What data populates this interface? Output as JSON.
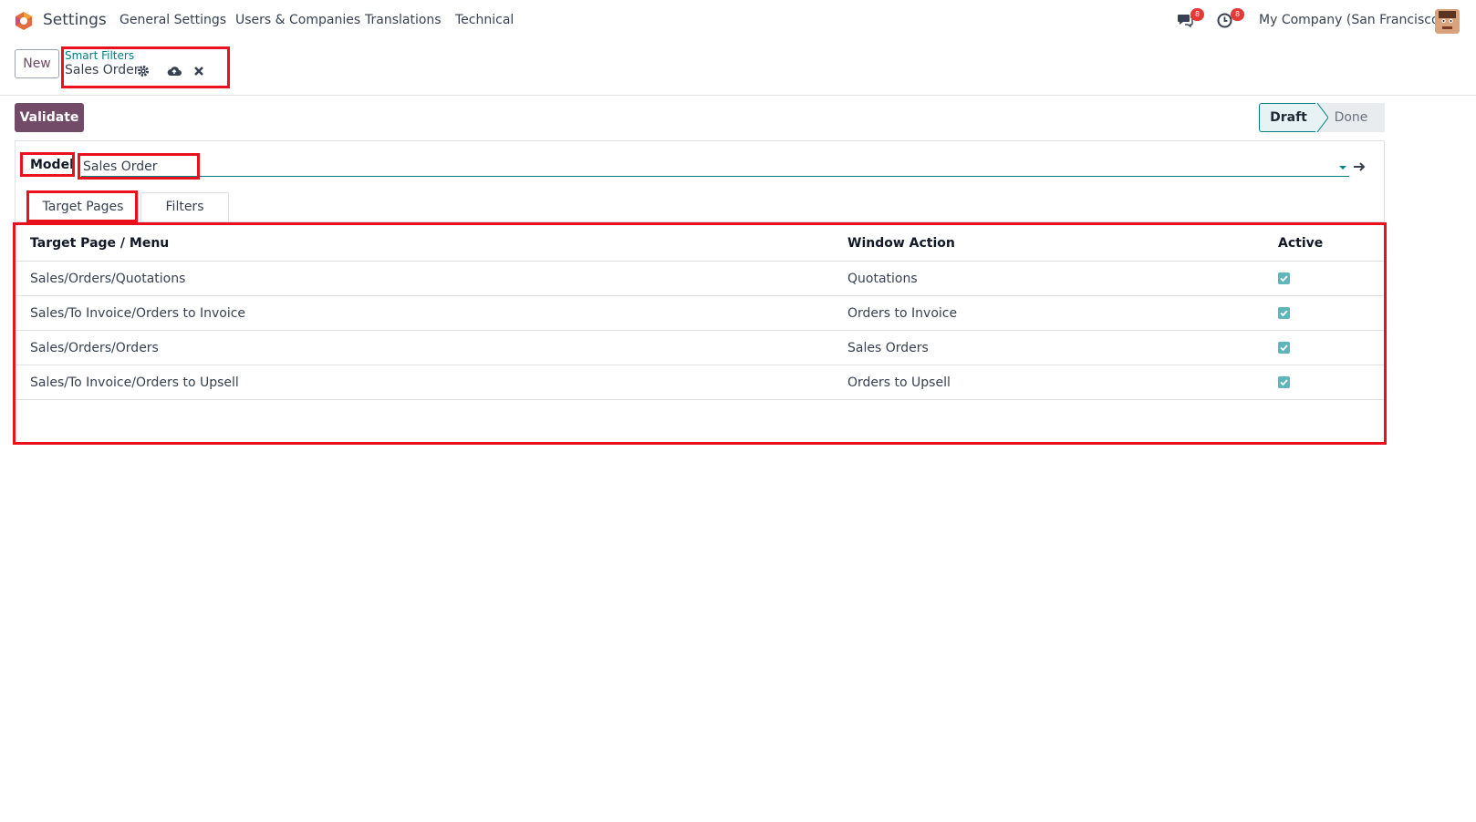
{
  "topnav": {
    "app_title": "Settings",
    "menu": [
      "General Settings",
      "Users & Companies",
      "Translations",
      "Technical"
    ],
    "messages_badge": "8",
    "activities_badge": "8",
    "company": "My Company (San Francisco)"
  },
  "control_panel": {
    "new_label": "New",
    "breadcrumb_parent": "Smart Filters",
    "breadcrumb_current": "Sales Order"
  },
  "form": {
    "validate_label": "Validate",
    "status": {
      "stages": [
        "Draft",
        "Done"
      ],
      "current": "Draft"
    },
    "model_label": "Model",
    "model_value": "Sales Order",
    "tabs": [
      "Target Pages",
      "Filters"
    ],
    "active_tab": "Target Pages"
  },
  "table": {
    "columns": [
      "Target Page / Menu",
      "Window Action",
      "Active"
    ],
    "rows": [
      {
        "target": "Sales/Orders/Quotations",
        "action": "Quotations",
        "active": true
      },
      {
        "target": "Sales/To Invoice/Orders to Invoice",
        "action": "Orders to Invoice",
        "active": true
      },
      {
        "target": "Sales/Orders/Orders",
        "action": "Sales Orders",
        "active": true
      },
      {
        "target": "Sales/To Invoice/Orders to Upsell",
        "action": "Orders to Upsell",
        "active": true
      }
    ]
  },
  "colors": {
    "brand": "#714b67",
    "accent": "#017e84",
    "highlight_box": "#e8111d",
    "badge": "#e53935"
  }
}
